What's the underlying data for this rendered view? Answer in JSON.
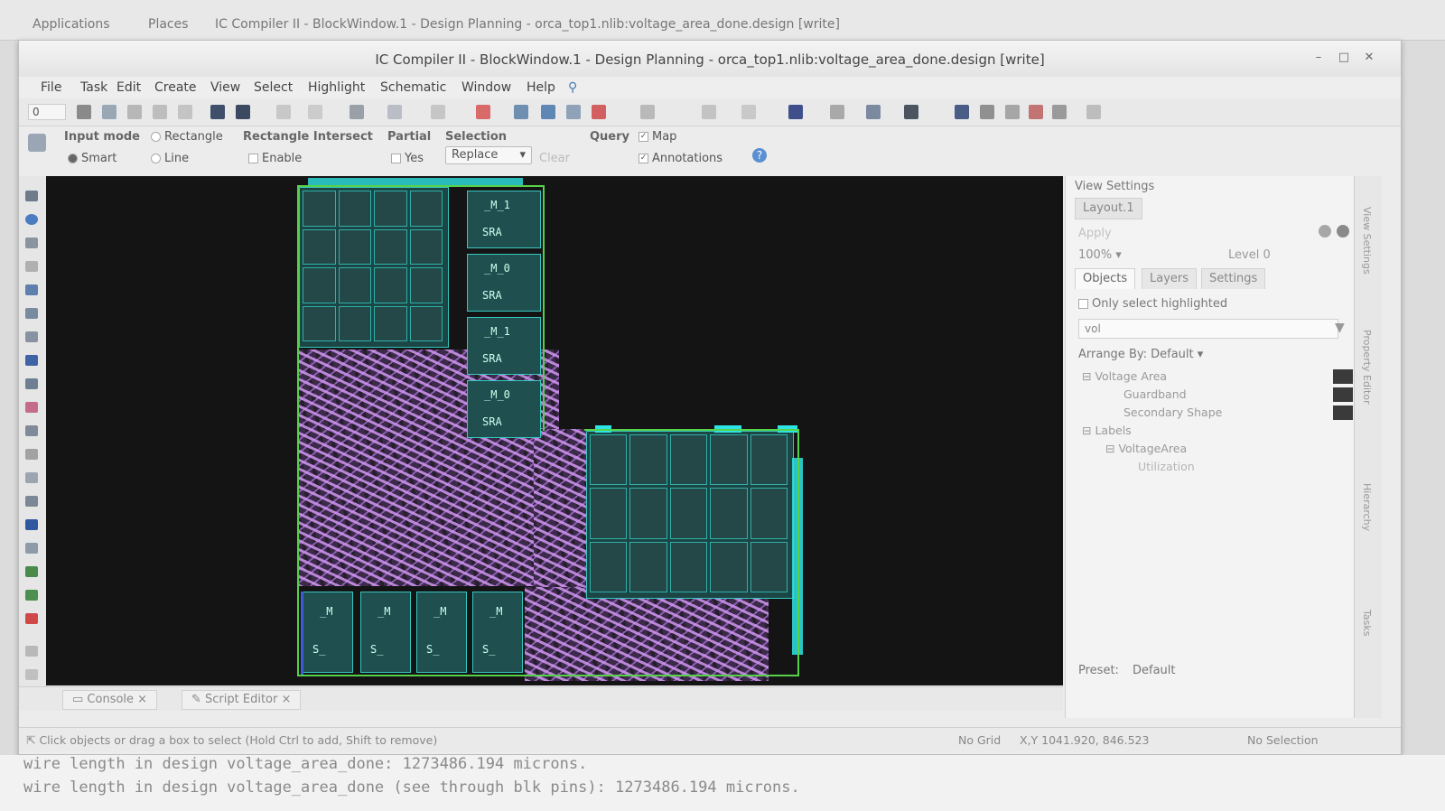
{
  "desktop_panel": {
    "applications": "Applications",
    "places": "Places",
    "task_title": "IC Compiler II - BlockWindow.1 - Design Planning - orca_top1.nlib:voltage_area_done.design [write]"
  },
  "window": {
    "title": "IC Compiler II - BlockWindow.1 - Design Planning - orca_top1.nlib:voltage_area_done.design [write]"
  },
  "menu": [
    "File",
    "Task",
    "Edit",
    "Create",
    "View",
    "Select",
    "Highlight",
    "Schematic",
    "Window",
    "Help"
  ],
  "toolbar": {
    "spin_value": "0"
  },
  "options_bar": {
    "input_mode_label": "Input mode",
    "rectangle": "Rectangle",
    "smart": "Smart",
    "line": "Line",
    "rect_intersect_label": "Rectangle Intersect",
    "enable": "Enable",
    "partial_label": "Partial",
    "yes": "Yes",
    "selection_label": "Selection",
    "replace": "Replace",
    "clear": "Clear",
    "query_label": "Query",
    "map": "Map",
    "annotations": "Annotations"
  },
  "layout_labels": {
    "top_blocks": [
      "_M_1",
      "SRA",
      "_M_0",
      "SRA",
      "_M_1",
      "SRA",
      "_M_0",
      "SRA"
    ],
    "bottom_blocks": [
      "_M",
      "S_",
      "_M",
      "S_",
      "_M",
      "S_",
      "_M",
      "S_"
    ]
  },
  "view_settings": {
    "header": "View Settings",
    "layout_tab": "Layout.1",
    "apply": "Apply",
    "zoom": "100%",
    "level": "Level 0",
    "tabs": [
      "Objects",
      "Layers",
      "Settings"
    ],
    "only_select_highlighted": "Only select highlighted",
    "filter_value": "vol",
    "arrange_by": "Arrange By: Default",
    "tree": [
      "Voltage Area",
      "Guardband",
      "Secondary Shape",
      "Labels",
      "VoltageArea",
      "Utilization"
    ],
    "preset_label": "Preset:",
    "preset_value": "Default"
  },
  "side_strip": [
    "View Settings",
    "Property Editor",
    "Hierarchy",
    "Tasks"
  ],
  "bottom_tabs": [
    "Console",
    "Script Editor"
  ],
  "status": {
    "hint": "Click objects or drag a box to select (Hold Ctrl to add, Shift to remove)",
    "grid": "No Grid",
    "coords": "X,Y 1041.920, 846.523",
    "selection": "No Selection"
  },
  "terminal": [
    "wire length in design voltage_area_done: 1273486.194 microns.",
    "wire length in design voltage_area_done (see through blk pins): 1273486.194 microns."
  ]
}
